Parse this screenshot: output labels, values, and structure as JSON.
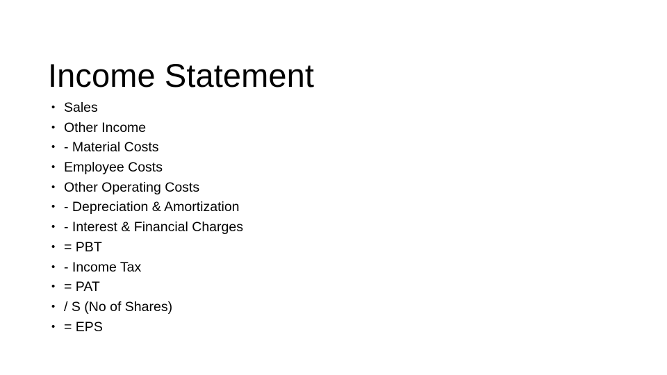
{
  "slide": {
    "title": "Income Statement",
    "background_color": "#ffffff",
    "text_color": "#000000",
    "bullet_glyph": "•",
    "items": [
      {
        "label": "Sales"
      },
      {
        "label": "Other Income"
      },
      {
        "label": "- Material Costs"
      },
      {
        "label": "Employee Costs"
      },
      {
        "label": "Other Operating Costs"
      },
      {
        "label": "- Depreciation & Amortization"
      },
      {
        "label": "- Interest & Financial Charges"
      },
      {
        "label": "= PBT"
      },
      {
        "label": "- Income Tax"
      },
      {
        "label": "= PAT"
      },
      {
        "label": "/ S (No of Shares)"
      },
      {
        "label": "= EPS"
      }
    ]
  }
}
